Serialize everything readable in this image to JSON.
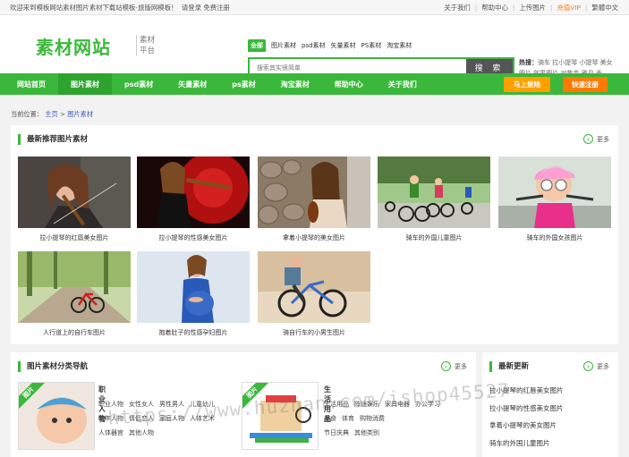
{
  "topbar": {
    "welcome": "欢迎来到模板网站素材图片素材下载站模板-旅版网模板！",
    "login_link": "请登录",
    "register_link": "免费注册",
    "links": [
      "关于我们",
      "帮助中心",
      "上传图片",
      "充值VIP",
      "繁體中文"
    ]
  },
  "header": {
    "logo": "素材网站",
    "logo_sub_1": "素材",
    "logo_sub_2": "平台",
    "search_tabs": [
      "全部",
      "图片素材",
      "psd素材",
      "矢量素材",
      "PS素材",
      "淘宝素材"
    ],
    "search_placeholder": "搜索其实很简单",
    "search_button": "搜 索",
    "hot_label": "热搜：",
    "hot_words": "骑车 拉小提琴 小提琴 美女图片 效果图片 对焦金 雅月 香"
  },
  "nav": {
    "items": [
      "网站首页",
      "图片素材",
      "psd素材",
      "矢量素材",
      "ps素材",
      "淘宝素材",
      "帮助中心",
      "关于我们"
    ],
    "active_index": 1,
    "login_button": "马上登陆",
    "register_button": "快速注册"
  },
  "breadcrumb": {
    "label": "当前位置：",
    "home": "主页",
    "sep": ">",
    "current": "图片素材"
  },
  "recommend": {
    "title": "最新推荐图片素材",
    "more": "更多",
    "items": [
      {
        "caption": "拉小提琴的红唇美女图片"
      },
      {
        "caption": "拉小提琴的性感美女图片"
      },
      {
        "caption": "拿着小提琴的美女图片"
      },
      {
        "caption": "骑车的外国儿童图片"
      },
      {
        "caption": "骑车的外国女孩图片"
      },
      {
        "caption": "人行道上的自行车图片"
      },
      {
        "caption": "抱着肚子的性感孕妇图片"
      },
      {
        "caption": "骑自行车的小男生图片"
      }
    ]
  },
  "categories": {
    "title": "图片素材分类导航",
    "more": "更多",
    "ribbon": "图片",
    "blocks": [
      {
        "name": "职业人物",
        "links": [
          "职业人物",
          "女性女人",
          "男性男人",
          "儿童幼儿",
          "老年人物",
          "情侣恋人",
          "家庭人物",
          "人体艺术",
          "人体器官",
          "其他人物"
        ]
      },
      {
        "name": "生活用品",
        "links": [
          "生活用品",
          "阵途娱乐",
          "家具电器",
          "办公学习",
          "美食",
          "体育",
          "购物消费",
          "节日庆典",
          "其他类别"
        ]
      }
    ]
  },
  "latest": {
    "title": "最新更新",
    "more": "更多",
    "items": [
      "拉小提琴的红唇美女图片",
      "拉小提琴的性感美女图片",
      "拿着小提琴的美女图片",
      "骑车的外国儿童图片"
    ]
  },
  "watermark": "https://www.huzhan.com/ishop45527"
}
